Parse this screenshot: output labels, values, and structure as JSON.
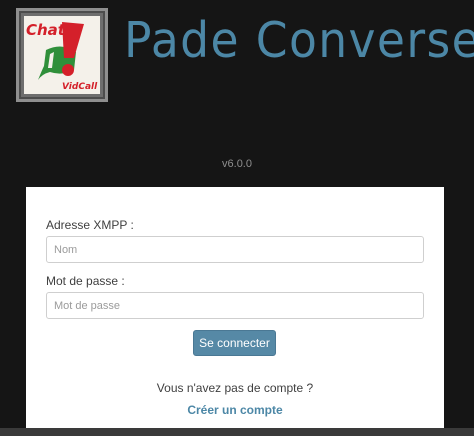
{
  "header": {
    "logo": {
      "text_top": "Chat",
      "text_bottom": "VidCall",
      "icon": "chat-vidcall-logo"
    },
    "title": "Pade Converse",
    "version": "v6.0.0"
  },
  "login_form": {
    "jid_label": "Adresse XMPP :",
    "jid_placeholder": "Nom",
    "password_label": "Mot de passe :",
    "password_placeholder": "Mot de passe",
    "submit_label": "Se connecter",
    "register_prompt": "Vous n'avez pas de compte ?",
    "register_link": "Créer un compte"
  },
  "colors": {
    "background": "#151515",
    "brand": "#4c87a6",
    "button": "#5689a6",
    "logo_red": "#d4202a",
    "logo_green": "#2f8f3a"
  }
}
